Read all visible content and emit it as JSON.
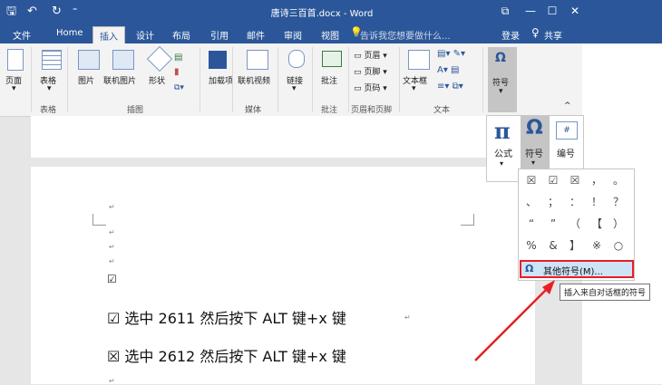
{
  "window": {
    "title": "唐诗三百首.docx - Word",
    "min": "—",
    "max": "☐",
    "close": "✕",
    "ribbon_display": "⧉"
  },
  "qat": {
    "save": "🖫",
    "undo": "↶",
    "redo": "↻",
    "more": "⁼"
  },
  "tabs": [
    "文件",
    "Home",
    "插入",
    "设计",
    "布局",
    "引用",
    "邮件",
    "审阅",
    "视图"
  ],
  "active_tab": "插入",
  "tellme": "告诉我您想要做什么...",
  "login": "登录",
  "share": "共享",
  "ribbon": {
    "pages": "页面",
    "table": "表格",
    "pictures": "图片",
    "online_pictures": "联机图片",
    "shapes": "形状",
    "addins": "加载项",
    "online_video": "联机视频",
    "links": "链接",
    "comment": "批注",
    "header": "页眉",
    "footer": "页脚",
    "page_number": "页码",
    "textbox": "文本框",
    "symbols": "符号",
    "groups": {
      "tables": "表格",
      "illustrations": "插图",
      "media": "媒体",
      "comments": "批注",
      "header_footer": "页眉和页脚",
      "text": "文本"
    },
    "collapse": "^"
  },
  "symbols_panel": {
    "equation_glyph": "π",
    "equation": "公式",
    "symbol_glyph": "Ω",
    "symbol": "符号",
    "number_glyph": "#",
    "number": "编号"
  },
  "symbol_grid": {
    "cells": [
      [
        "☒",
        "☑",
        "☒",
        "，",
        "。"
      ],
      [
        "、",
        "；",
        "：",
        "！",
        "？"
      ],
      [
        "“",
        "”",
        "（",
        "【",
        "）"
      ],
      [
        "%",
        "&",
        "】",
        "※",
        "○"
      ]
    ],
    "more_label": "其他符号(M)...",
    "omega": "Ω"
  },
  "tooltip": "插入来自对话框的符号",
  "document": {
    "mark": "↵",
    "checkbox_small": "☑",
    "line1": "☑ 选中 2611 然后按下 ALT 键+x 键",
    "line2": "☒ 选中 2612 然后按下 ALT 键+x 键"
  },
  "colors": {
    "accent": "#2b579a",
    "highlight": "#e81e25"
  }
}
